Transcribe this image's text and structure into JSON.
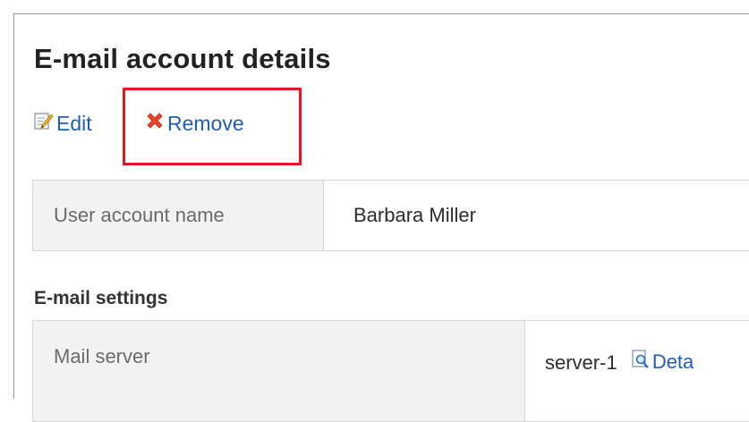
{
  "page": {
    "title": "E-mail account details"
  },
  "actions": {
    "edit_label": "Edit",
    "remove_label": "Remove"
  },
  "account": {
    "label": "User account name",
    "value": "Barbara Miller"
  },
  "email_settings": {
    "section_title": "E-mail settings",
    "mail_server_label": "Mail server",
    "mail_server_value": "server-1",
    "details_label": "Deta"
  },
  "colors": {
    "link": "#1f5fb5",
    "highlight": "#e8141e",
    "label_bg": "#f2f2f2"
  },
  "icons": {
    "edit": "edit-pencil-icon",
    "remove": "red-x-icon",
    "details": "magnifier-document-icon"
  }
}
